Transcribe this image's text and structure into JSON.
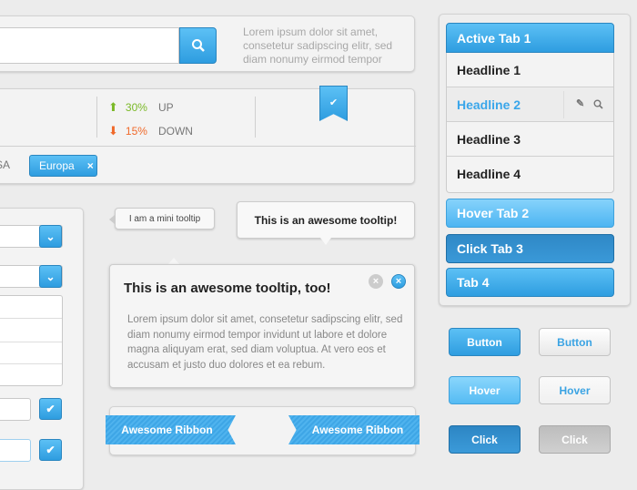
{
  "search": {
    "button_icon": "search-icon",
    "description": "Lorem ipsum dolor sit amet, consetetur sadipscing elitr, sed diam nonumy eirmod tempor"
  },
  "stats": {
    "up": {
      "value": "30%",
      "label": "UP",
      "color": "#7bb928"
    },
    "down": {
      "value": "15%",
      "label": "DOWN",
      "color": "#f06a2b"
    },
    "bookmark_icon": "check-icon"
  },
  "tags": {
    "partial": "SA",
    "active": "Europa",
    "remove": "×"
  },
  "tooltips": {
    "mini": "I am a mini tooltip",
    "awesome": "This is an awesome tooltip!",
    "big_title": "This is an awesome tooltip, too!",
    "big_body": "Lorem ipsum dolor sit amet, consetetur sadipscing elitr, sed diam nonumy eirmod tempor invidunt ut labore et dolore magna aliquyam erat, sed diam voluptua. At vero eos et accusam et justo duo dolores et ea rebum."
  },
  "ribbons": {
    "left": "Awesome Ribbon",
    "right": "Awesome Ribbon"
  },
  "accordion": {
    "active_tab": "Active Tab 1",
    "headlines": [
      "Headline 1",
      "Headline 2",
      "Headline 3",
      "Headline 4"
    ],
    "hover_tab": "Hover Tab 2",
    "click_tab": "Click Tab 3",
    "tab4": "Tab 4"
  },
  "buttons": {
    "button": "Button",
    "hover": "Hover",
    "click": "Click"
  },
  "colors": {
    "accent": "#3aa3e3",
    "up": "#7bb928",
    "down": "#f06a2b"
  }
}
